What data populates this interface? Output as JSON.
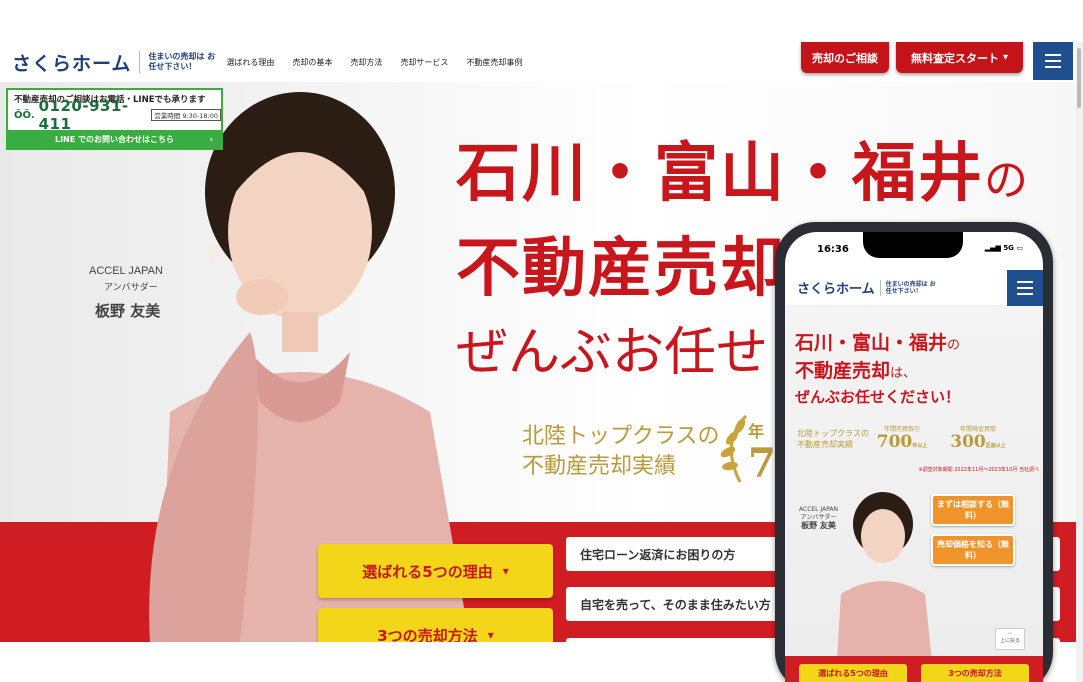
{
  "header": {
    "logo": "さくらホーム",
    "tagline": "住まいの売却は お任せ下さい！",
    "nav": [
      "選ばれる理由",
      "売却の基本",
      "売却方法",
      "売却サービス",
      "不動産売却事例"
    ],
    "consult_button": "売却のご相談",
    "assess_button": "無料査定スタート",
    "menu_icon": "hamburger-icon"
  },
  "contact": {
    "title": "不動産売却のご相談はお電話・LINEでも承ります",
    "free_dial": "ÕÕ.",
    "tel": "0120-931-411",
    "hours": "営業時間 9:30-18:00",
    "line_label": "LINE でのお問い合わせはこちら",
    "line_arrow": "›"
  },
  "ambassador": {
    "org": "ACCEL JAPAN",
    "role": "アンバサダー",
    "name": "板野 友美"
  },
  "hero": {
    "title_line1": "石川・富山・福井",
    "title_no": "の",
    "title_line2": "不動産売却",
    "title_line3": "ぜんぶお任せください！",
    "sub_line1": "北陸トップクラスの",
    "sub_line2": "不動産売却実績",
    "award_label": "年",
    "award_value": "7"
  },
  "buttons": {
    "reasons": "選ばれる5つの理由",
    "methods": "3つの売却方法",
    "chev": "⌄",
    "loan": "住宅ローン返済にお困りの方",
    "leaseback": "自宅を売って、そのまま住みたい方",
    "third": ""
  },
  "phone": {
    "time": "16:36",
    "signal": "5G",
    "logo": "さくらホーム",
    "tagline": "住まいの売却は お任せ下さい！",
    "title1": "石川・富山・福井",
    "title1_s": "の",
    "title2": "不動産売却",
    "title2_s": "は、",
    "title3": "ぜんぶお任せください！",
    "sub1": "北陸トップクラスの",
    "sub2": "不動産売却実績",
    "award1_label": "年間売買取引",
    "award1_value": "700",
    "award1_unit": "件以上",
    "award2_label": "年間現金買取",
    "award2_value": "300",
    "award2_unit": "区画以上",
    "note": "※調査対象期間 2022年11月〜2023年10月 当社調べ",
    "amb_org": "ACCEL JAPAN",
    "amb_role": "アンバサダー",
    "amb_name": "板野 友美",
    "orange1": "まずは相談する（無料）",
    "orange2": "売却価格を知る（無料）",
    "yellow1": "選ばれる5つの理由",
    "yellow2": "3つの売却方法",
    "to_top": "上に戻る"
  }
}
